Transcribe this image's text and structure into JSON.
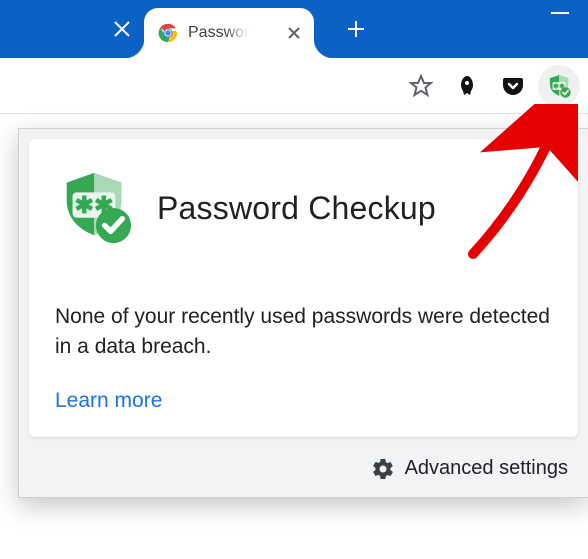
{
  "titlebar": {
    "tab_title": "Passwor",
    "prev_close_name": "close-prev-tab",
    "new_tab_name": "new-tab",
    "minimize_name": "window-minimize"
  },
  "toolbar": {
    "star_name": "bookmark-star",
    "rocket_name": "extension-rocket",
    "pocket_name": "extension-pocket",
    "pw_name": "extension-password-checkup"
  },
  "popup": {
    "title": "Password Checkup",
    "body": "None of your recently used passwords were detected in a data breach.",
    "learn_more": "Learn more",
    "advanced": "Advanced settings"
  }
}
